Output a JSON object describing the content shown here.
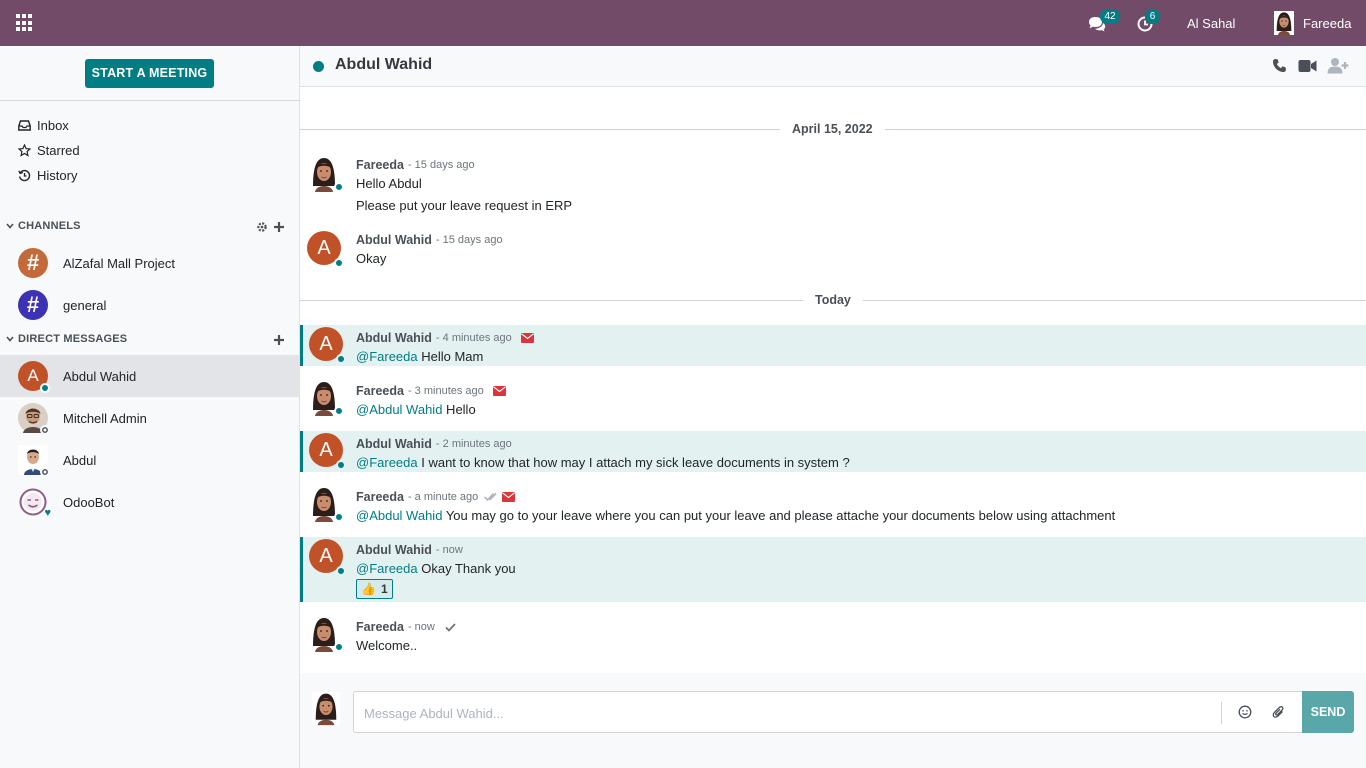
{
  "navbar": {
    "messages_badge": "42",
    "activities_badge": "6",
    "company": "Al Sahal",
    "user_name": "Fareeda"
  },
  "sidebar": {
    "start_meeting": "START A MEETING",
    "mailboxes": [
      {
        "label": "Inbox",
        "icon": "inbox-icon"
      },
      {
        "label": "Starred",
        "icon": "star-icon"
      },
      {
        "label": "History",
        "icon": "history-icon"
      }
    ],
    "channels_header": "CHANNELS",
    "channels": [
      {
        "label": "AlZafal Mall Project",
        "color": "#c36a3b"
      },
      {
        "label": "general",
        "color": "#3d31b5"
      }
    ],
    "dm_header": "DIRECT MESSAGES",
    "direct_messages": [
      {
        "label": "Abdul Wahid",
        "initial": "A",
        "status": "online",
        "active": true
      },
      {
        "label": "Mitchell Admin",
        "status": "offline",
        "active": false
      },
      {
        "label": "Abdul",
        "status": "offline",
        "active": false
      },
      {
        "label": "OdooBot",
        "status": "bot",
        "active": false
      }
    ]
  },
  "thread": {
    "title": "Abdul Wahid",
    "status_color": "#017e84"
  },
  "messages": {
    "date_1": "April 15, 2022",
    "date_2": "Today",
    "m1": {
      "author": "Fareeda",
      "when": "- 15 days ago",
      "line1": "Hello Abdul",
      "line2": "Please put your leave request in ERP"
    },
    "m2": {
      "author": "Abdul Wahid",
      "initial": "A",
      "when": "- 15 days ago",
      "line1": "Okay"
    },
    "m3": {
      "author": "Abdul Wahid",
      "initial": "A",
      "when": "- 4 minutes ago",
      "mention": "@Fareeda",
      "text": " Hello Mam"
    },
    "m4": {
      "author": "Fareeda",
      "when": "- 3 minutes ago",
      "mention": "@Abdul Wahid",
      "text": " Hello"
    },
    "m5": {
      "author": "Abdul Wahid",
      "initial": "A",
      "when": "- 2 minutes ago",
      "mention": "@Fareeda",
      "text": " I want to know that how may I attach my sick leave documents in system ?"
    },
    "m6": {
      "author": "Fareeda",
      "when": "- a minute ago",
      "mention": "@Abdul Wahid",
      "text": " You may go to your leave where you can put your leave and please attache your documents below using attachment"
    },
    "m7": {
      "author": "Abdul Wahid",
      "initial": "A",
      "when": "- now",
      "mention": "@Fareeda",
      "text": " Okay Thank you",
      "reaction_emoji": "👍",
      "reaction_count": "1"
    },
    "m8": {
      "author": "Fareeda",
      "when": "- now",
      "line1": "Welcome.."
    }
  },
  "composer": {
    "placeholder": "Message Abdul Wahid...",
    "send": "SEND"
  },
  "colors": {
    "brand": "#714B67",
    "accent": "#017e84",
    "highlight": "#e4f1f1",
    "envelope": "#d9353d"
  }
}
